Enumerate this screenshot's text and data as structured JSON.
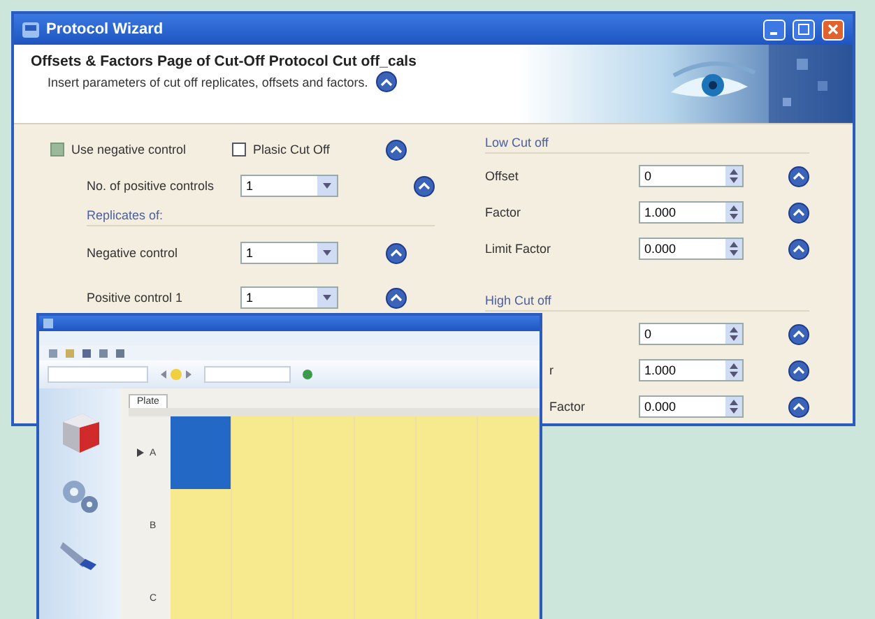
{
  "wizard": {
    "title": "Protocol Wizard",
    "heading": "Offsets & Factors Page of Cut-Off Protocol Cut off_cals",
    "subheading": "Insert parameters of cut off replicates, offsets and factors.",
    "options": [
      {
        "label": "Use negative control",
        "checked": true
      },
      {
        "label": "Plasic Cut Off",
        "checked": false
      }
    ],
    "positive_controls": {
      "label": "No. of positive controls",
      "value": "1"
    },
    "replicates": {
      "title": "Replicates of:",
      "rows": [
        {
          "label": "Negative control",
          "value": "1"
        },
        {
          "label": "Positive control 1",
          "value": "1"
        }
      ]
    },
    "low_cut_off": {
      "title": "Low Cut off",
      "rows": [
        {
          "label": "Offset",
          "value": "0"
        },
        {
          "label": "Factor",
          "value": "1.000"
        },
        {
          "label": "Limit Factor",
          "value": "0.000"
        }
      ]
    },
    "high_cut_off": {
      "title": "High Cut off",
      "rows": [
        {
          "value": "0"
        },
        {
          "label": "r",
          "value": "1.000"
        },
        {
          "label": "Factor",
          "value": "0.000"
        }
      ]
    }
  },
  "plate_window": {
    "tab": "Plate",
    "rows": [
      {
        "label": "A",
        "current": true,
        "cells": [
          {
            "selected": true
          },
          {
            "selected": false
          },
          {
            "selected": false
          },
          {
            "selected": false
          },
          {
            "selected": false
          },
          {
            "selected": false
          }
        ]
      },
      {
        "label": "B",
        "current": false,
        "cells": [
          {
            "selected": false
          },
          {
            "selected": false
          },
          {
            "selected": false
          },
          {
            "selected": false
          },
          {
            "selected": false
          },
          {
            "selected": false
          }
        ]
      },
      {
        "label": "C",
        "current": false,
        "cells": [
          {
            "selected": false
          },
          {
            "selected": false
          },
          {
            "selected": false
          },
          {
            "selected": false
          },
          {
            "selected": false
          },
          {
            "selected": false
          }
        ]
      }
    ]
  }
}
